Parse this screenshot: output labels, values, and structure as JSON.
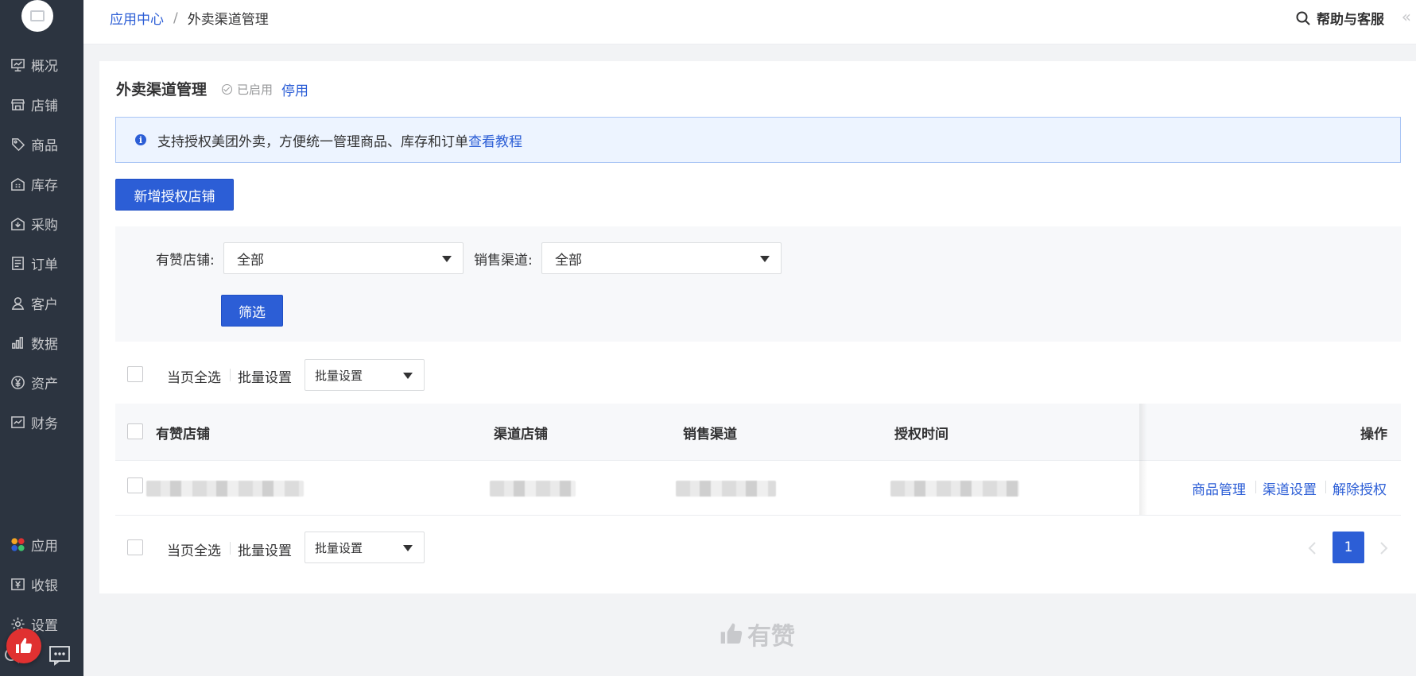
{
  "sidebar": {
    "items": [
      {
        "label": "概况",
        "icon": "dashboard-icon"
      },
      {
        "label": "店铺",
        "icon": "store-icon"
      },
      {
        "label": "商品",
        "icon": "tag-icon"
      },
      {
        "label": "库存",
        "icon": "warehouse-icon"
      },
      {
        "label": "采购",
        "icon": "purchase-icon"
      },
      {
        "label": "订单",
        "icon": "order-icon"
      },
      {
        "label": "客户",
        "icon": "user-icon"
      },
      {
        "label": "数据",
        "icon": "bar-chart-icon"
      },
      {
        "label": "资产",
        "icon": "yuan-icon"
      },
      {
        "label": "财务",
        "icon": "finance-icon"
      }
    ],
    "bottom_items": [
      {
        "label": "应用",
        "icon": "apps-icon"
      },
      {
        "label": "收银",
        "icon": "cashier-icon"
      },
      {
        "label": "设置",
        "icon": "gear-icon"
      }
    ]
  },
  "header": {
    "breadcrumb_root": "应用中心",
    "breadcrumb_sep": "/",
    "breadcrumb_current": "外卖渠道管理",
    "help": "帮助与客服",
    "collapse": "«"
  },
  "page": {
    "title": "外卖渠道管理",
    "status": "已启用",
    "disable": "停用"
  },
  "notice": {
    "text": "支持授权美团外卖，方便统一管理商品、库存和订单",
    "link": "查看教程",
    "icon_glyph": "i"
  },
  "actions": {
    "add_store": "新增授权店铺"
  },
  "filter": {
    "store_label": "有赞店铺:",
    "store_value": "全部",
    "channel_label": "销售渠道:",
    "channel_value": "全部",
    "submit": "筛选"
  },
  "bulk": {
    "select_all": "当页全选",
    "batch_label": "批量设置",
    "batch_select": "批量设置"
  },
  "table": {
    "columns": [
      "有赞店铺",
      "渠道店铺",
      "销售渠道",
      "授权时间",
      "操作"
    ],
    "row_actions": [
      "商品管理",
      "渠道设置",
      "解除授权"
    ]
  },
  "pagination": {
    "current": "1"
  },
  "brand": {
    "name": "有赞"
  },
  "colors": {
    "primary": "#2c5ed6",
    "sidebar": "#2c3440",
    "notice_bg": "#edf4ff"
  }
}
